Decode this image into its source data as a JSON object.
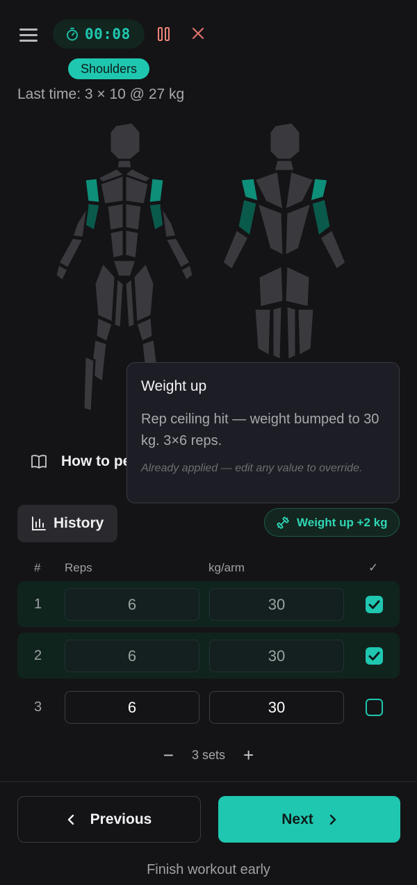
{
  "header": {
    "timer": "00:08",
    "icons": {
      "menu": "menu-icon",
      "timer": "stopwatch-icon",
      "pause": "pause-icon",
      "close": "close-icon"
    }
  },
  "exercise": {
    "muscle_group": "Shoulders",
    "last_time": "Last time: 3 × 10 @ 27 kg",
    "how_to_label": "How to pe"
  },
  "tooltip": {
    "title": "Weight up",
    "body": "Rep ceiling hit — weight bumped to 30 kg. 3×6 reps.",
    "note": "Already applied — edit any value to override."
  },
  "history_label": "History",
  "weight_badge": "Weight up +2 kg",
  "table": {
    "headers": {
      "num": "#",
      "reps": "Reps",
      "kg": "kg/arm",
      "check": "✓"
    },
    "rows": [
      {
        "num": "1",
        "reps": "6",
        "kg": "30",
        "done": true
      },
      {
        "num": "2",
        "reps": "6",
        "kg": "30",
        "done": true
      },
      {
        "num": "3",
        "reps": "6",
        "kg": "30",
        "done": false
      }
    ]
  },
  "sets": {
    "label": "3 sets",
    "minus": "−",
    "plus": "+"
  },
  "nav": {
    "previous": "Previous",
    "next": "Next"
  },
  "finish": "Finish workout early",
  "colors": {
    "accent": "#1fc7b0",
    "background": "#141416",
    "muscle_highlight": "#0e8f7a",
    "body": "#3a393e"
  }
}
